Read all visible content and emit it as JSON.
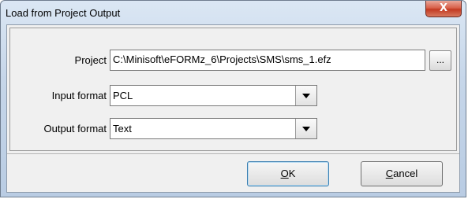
{
  "window": {
    "title": "Load from Project Output",
    "close_glyph": "X"
  },
  "form": {
    "project_label": "Project",
    "project_value": "C:\\Minisoft\\eFORMz_6\\Projects\\SMS\\sms_1.efz",
    "browse_label": "...",
    "input_format_label": "Input format",
    "input_format_value": "PCL",
    "output_format_label": "Output format",
    "output_format_value": "Text"
  },
  "buttons": {
    "ok_mnemonic": "O",
    "ok_rest": "K",
    "cancel_mnemonic": "C",
    "cancel_rest": "ancel"
  },
  "colors": {
    "titlebar": "#c6d6e9",
    "close_button": "#c23a22",
    "dialog_bg": "#f0f0f0",
    "default_button_border": "#3c7fb1"
  }
}
